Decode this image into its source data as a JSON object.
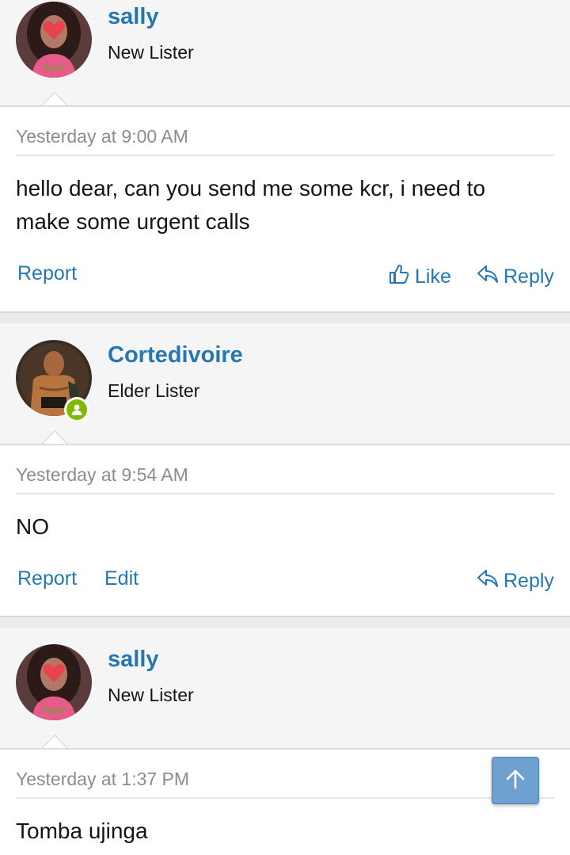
{
  "posts": [
    {
      "username": "sally",
      "user_title": "New Lister",
      "timestamp": "Yesterday at 9:00 AM",
      "message_lines": [
        "hello dear, can you send me some kcr, i need to",
        "make some urgent calls"
      ],
      "actions_left": [
        "Report"
      ],
      "like_label": "Like",
      "reply_label": "Reply",
      "avatar_icon": "female-user-avatar"
    },
    {
      "username": "Cortedivoire",
      "user_title": "Elder Lister",
      "timestamp": "Yesterday at 9:54 AM",
      "message_lines": [
        "NO"
      ],
      "actions_left": [
        "Report",
        "Edit"
      ],
      "reply_label": "Reply",
      "avatar_icon": "wrestler-avatar",
      "online_status_icon": "online-user-icon"
    },
    {
      "username": "sally",
      "user_title": "New Lister",
      "timestamp": "Yesterday at 1:37 PM",
      "message_lines": [
        "Tomba ujinga"
      ],
      "avatar_icon": "female-user-avatar"
    }
  ],
  "colors": {
    "link": "#2577b1",
    "online": "#7fb900",
    "scroll_button": "#6ea1cf"
  },
  "scroll_top_icon": "arrow-up-icon"
}
